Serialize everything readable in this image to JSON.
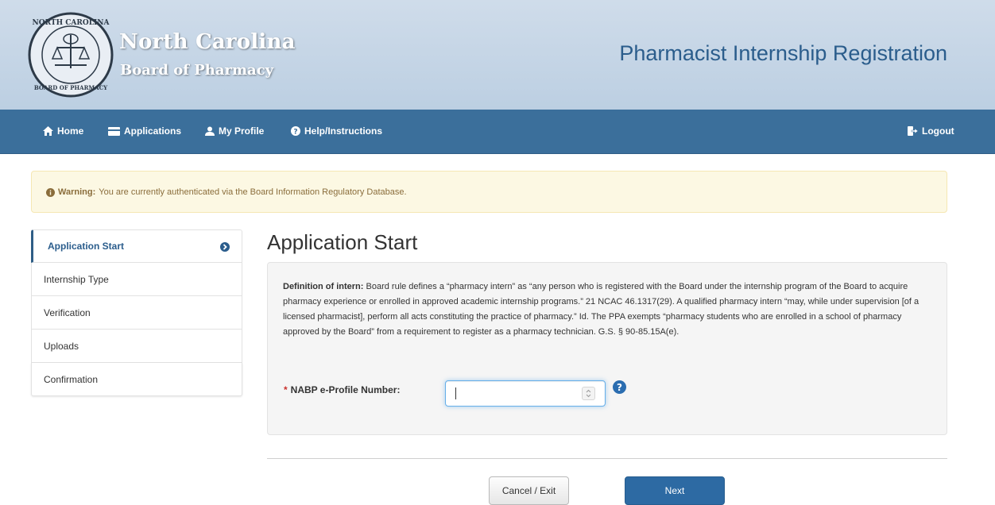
{
  "header": {
    "brand_line1": "North Carolina",
    "brand_line2": "Board of Pharmacy",
    "app_title": "Pharmacist Internship Registration",
    "seal_text_top": "NORTH CAROLINA",
    "seal_text_bottom": "BOARD OF PHARMACY"
  },
  "nav": {
    "home": "Home",
    "applications": "Applications",
    "profile": "My Profile",
    "help": "Help/Instructions",
    "logout": "Logout"
  },
  "warning": {
    "label": "Warning:",
    "message": "You are currently authenticated via the Board Information Regulatory Database."
  },
  "sidebar": {
    "items": [
      {
        "label": "Application Start"
      },
      {
        "label": "Internship Type"
      },
      {
        "label": "Verification"
      },
      {
        "label": "Uploads"
      },
      {
        "label": "Confirmation"
      }
    ]
  },
  "main": {
    "title": "Application Start",
    "definition_label": "Definition of intern:",
    "definition_text": "Board rule defines a “pharmacy intern” as “any person who is registered with the Board under the internship program of the Board to acquire pharmacy experience or enrolled in approved academic internship programs.” 21 NCAC 46.1317(29). A qualified pharmacy intern “may, while under supervision [of a licensed pharmacist], perform all acts constituting the practice of pharmacy.” Id. The PPA exempts “pharmacy students who are enrolled in a school of pharmacy approved by the Board” from a requirement to register as a pharmacy technician. G.S. § 90-85.15A(e).",
    "required_marker": "*",
    "nabp_label": "NABP e-Profile Number:",
    "nabp_value": ""
  },
  "buttons": {
    "cancel": "Cancel / Exit",
    "next": "Next"
  },
  "colors": {
    "navbar": "#3b6f9b",
    "title_blue": "#2b5d8c",
    "warning_bg": "#fcf8e3",
    "next_button": "#2d6aa3"
  }
}
